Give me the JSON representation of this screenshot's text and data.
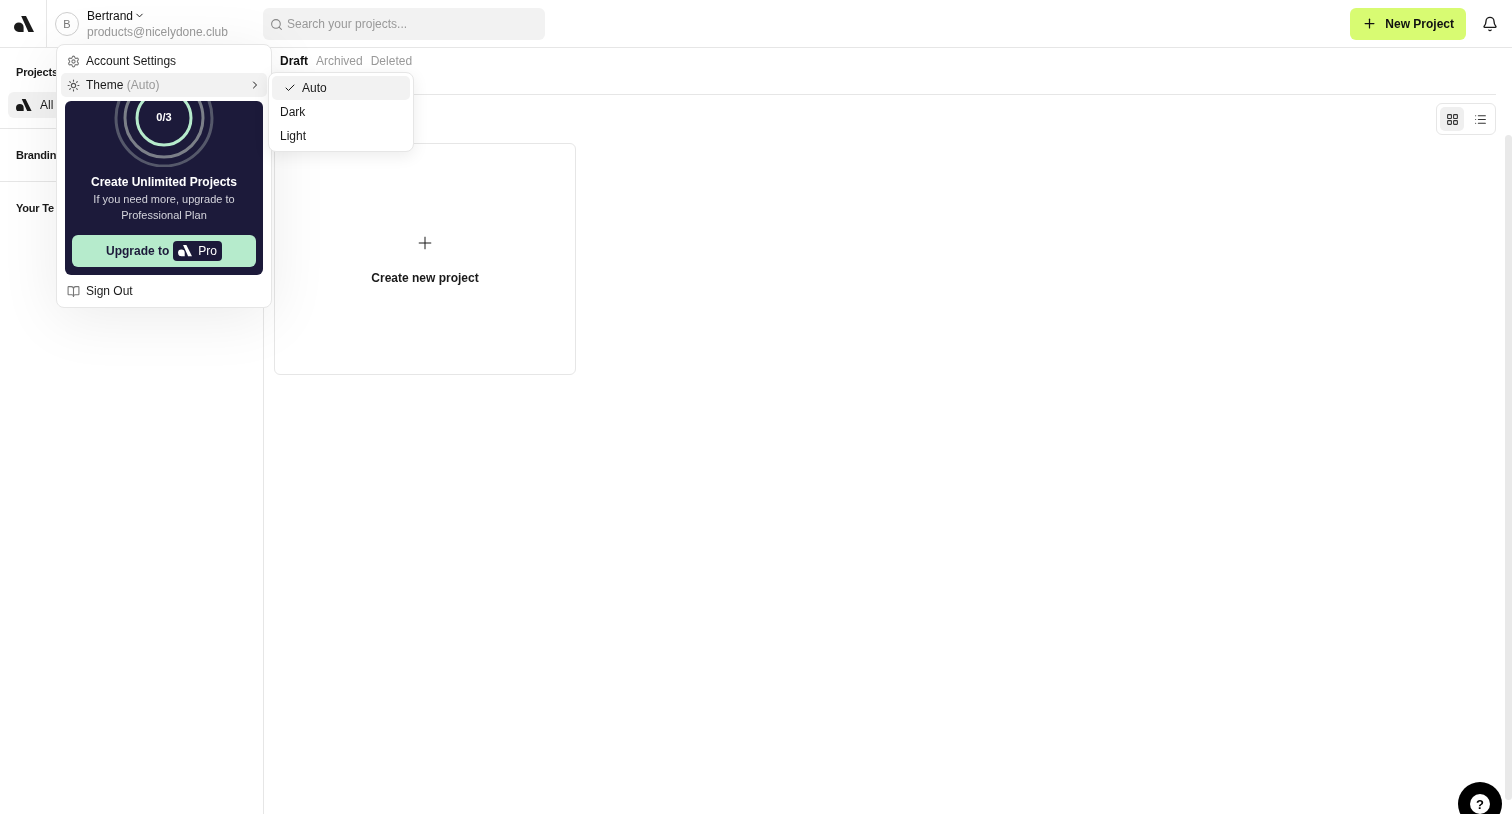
{
  "header": {
    "user": {
      "initial": "B",
      "name": "Bertrand",
      "email": "products@nicelydone.club"
    },
    "search": {
      "placeholder": "Search your projects..."
    },
    "new_project_button": "New Project"
  },
  "sidebar": {
    "items": [
      {
        "kind": "heading",
        "label": "Projects",
        "selected": false
      },
      {
        "kind": "item",
        "label": "All",
        "selected": true
      },
      {
        "kind": "section",
        "label": "Brandin",
        "selected": false
      },
      {
        "kind": "section",
        "label": "Your Te",
        "selected": false
      }
    ]
  },
  "tabs": [
    {
      "label": "Draft",
      "selected": true
    },
    {
      "label": "Archived",
      "selected": false
    },
    {
      "label": "Deleted",
      "selected": false
    }
  ],
  "view_toggle": [
    {
      "kind": "grid",
      "selected": true
    },
    {
      "kind": "list",
      "selected": false
    }
  ],
  "create_card": {
    "label": "Create new project"
  },
  "account_menu": {
    "items": [
      {
        "kind": "settings",
        "label": "Account Settings"
      },
      {
        "kind": "theme",
        "label": "Theme",
        "hint": "(Auto)",
        "expanded": true
      }
    ],
    "promo": {
      "count": "0/3",
      "title": "Create Unlimited Projects",
      "text": "If you need more, upgrade to Professional Plan",
      "button": "Upgrade to",
      "badge": "Pro"
    },
    "sign_out": "Sign Out"
  },
  "theme_menu": [
    {
      "label": "Auto",
      "selected": true
    },
    {
      "label": "Dark",
      "selected": false
    },
    {
      "label": "Light",
      "selected": false
    }
  ],
  "help_button": "?"
}
